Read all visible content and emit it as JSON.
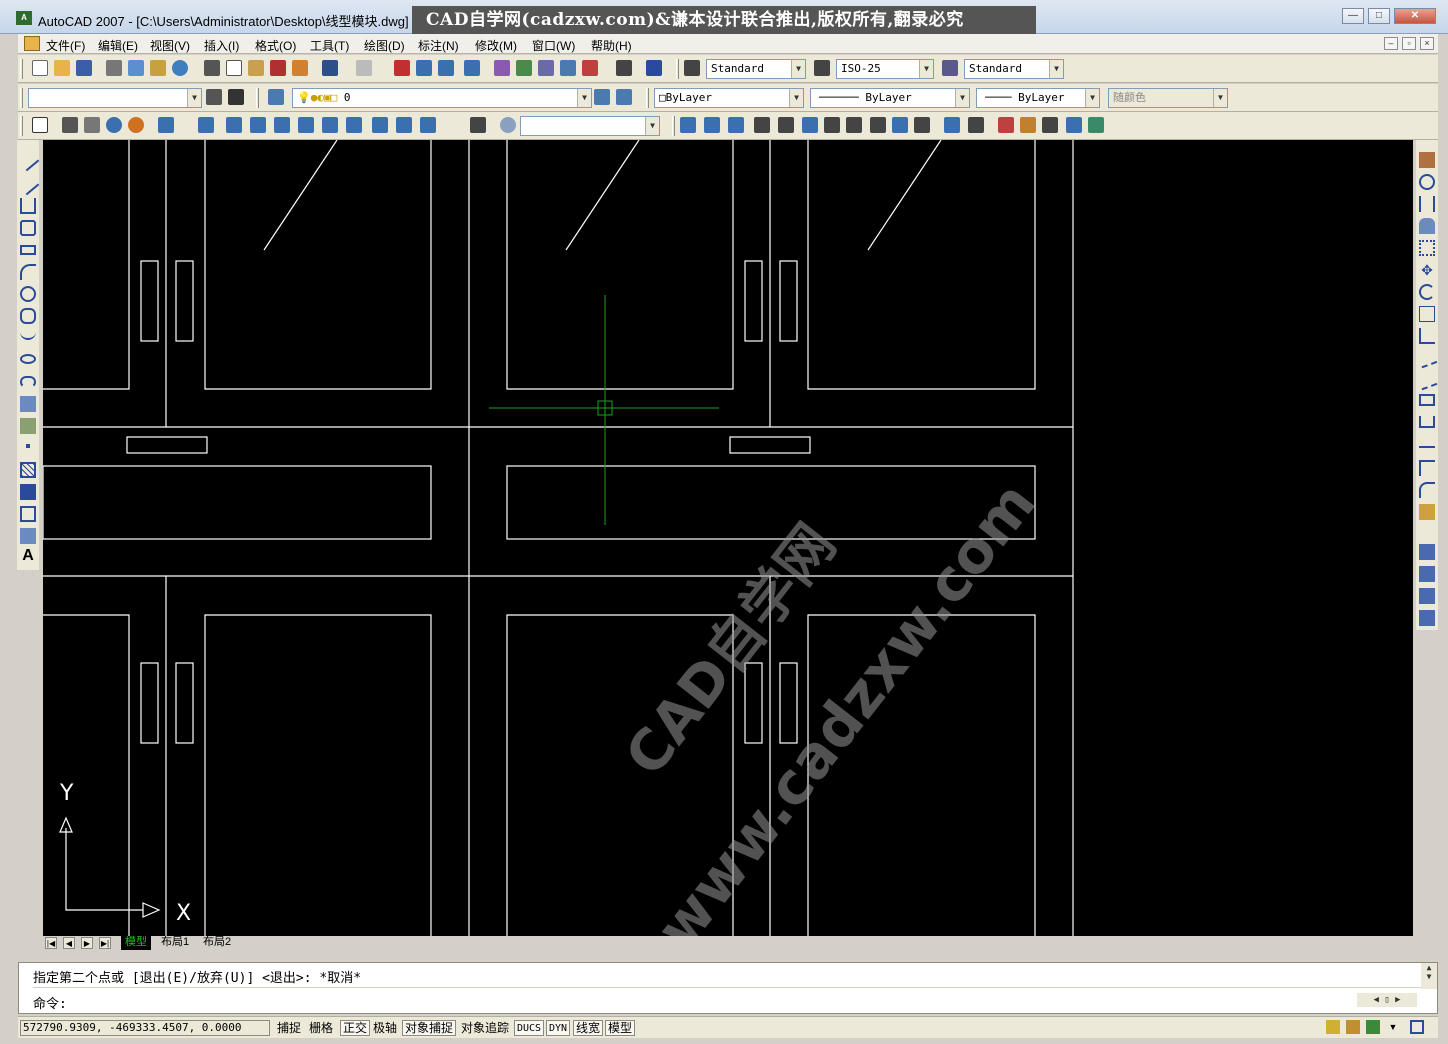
{
  "window": {
    "title": "AutoCAD 2007 - [C:\\Users\\Administrator\\Desktop\\线型模块.dwg]",
    "banner": "CAD自学网(cadzxw.com)&谦本设计联合推出,版权所有,翻录必究",
    "minimize": "—",
    "restore": "□",
    "close": "✕"
  },
  "menu": {
    "items": [
      "文件(F)",
      "编辑(E)",
      "视图(V)",
      "插入(I)",
      "格式(O)",
      "工具(T)",
      "绘图(D)",
      "标注(N)",
      "修改(M)",
      "窗口(W)",
      "帮助(H)"
    ],
    "mdi_min": "–",
    "mdi_restore": "▫",
    "mdi_close": "×"
  },
  "toolbar_styles": {
    "text_style": "Standard",
    "dim_style": "ISO-25",
    "table_style": "Standard"
  },
  "toolbar_layers": {
    "workspace_combo": "",
    "layer_name": "0"
  },
  "toolbar_properties": {
    "color": "ByLayer",
    "linetype": "ByLayer",
    "lineweight": "ByLayer",
    "plotstyle": "随颜色"
  },
  "toolbar_view": {
    "view_combo": ""
  },
  "canvas": {
    "ucs_y": "Y",
    "ucs_x": "X",
    "watermark_1": "CAD自学网",
    "watermark_2": "www.cadzxw.com"
  },
  "tabs": {
    "nav": [
      "|◀",
      "◀",
      "▶",
      "▶|"
    ],
    "items": [
      "模型",
      "布局1",
      "布局2"
    ],
    "active": "模型"
  },
  "command": {
    "history": "指定第二个点或 [退出(E)/放弃(U)] <退出>:  *取消*",
    "prompt": "命令:"
  },
  "status": {
    "coordinates": "572790.9309,  -469333.4507,  0.0000",
    "toggles": [
      {
        "label": "捕捉",
        "on": false
      },
      {
        "label": "栅格",
        "on": false
      },
      {
        "label": "正交",
        "on": true
      },
      {
        "label": "极轴",
        "on": false
      },
      {
        "label": "对象捕捉",
        "on": true
      },
      {
        "label": "对象追踪",
        "on": false
      },
      {
        "label": "DUCS",
        "on": true
      },
      {
        "label": "DYN",
        "on": true
      },
      {
        "label": "线宽",
        "on": true
      },
      {
        "label": "模型",
        "on": true
      }
    ]
  },
  "colors": {
    "canvas": "#000000",
    "lines": "#ffffff",
    "crosshair": "#1fa01f",
    "active_tab": "#18c318"
  }
}
